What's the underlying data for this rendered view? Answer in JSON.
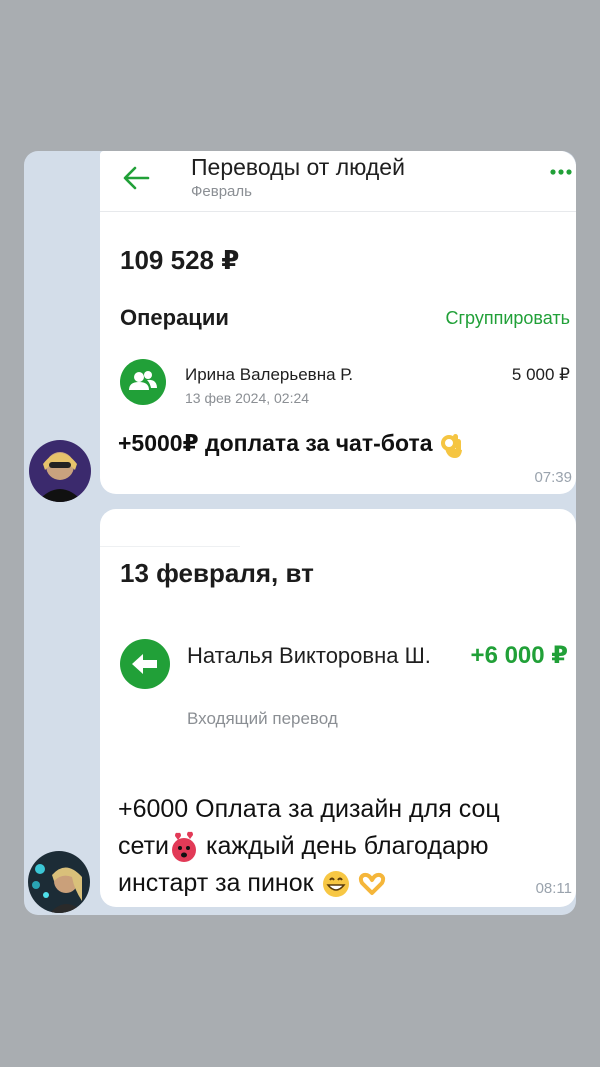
{
  "header": {
    "title": "Переводы от людей",
    "subtitle": "Февраль"
  },
  "summary": {
    "total": "109 528 ₽",
    "operations_label": "Операции",
    "group_button": "Сгруппировать"
  },
  "transaction1": {
    "name": "Ирина Валерьевна Р.",
    "date": "13 фев 2024, 02:24",
    "amount": "5 000 ₽"
  },
  "message1": {
    "text": "+5000₽ доплата за чат-бота",
    "emoji": "ok-hand-emoji",
    "time": "07:39"
  },
  "screenshot2": {
    "date_header": "13 февраля, вт",
    "name": "Наталья Викторовна Ш.",
    "amount": "+6 000 ₽",
    "type": "Входящий перевод"
  },
  "message2": {
    "line1": "+6000 Оплата за дизайн для соц",
    "line2_a": "сети",
    "line2_b": "каждый день благодарю",
    "line3": "инстарт за пинок",
    "emojis": [
      "face-with-hearts-emoji",
      "grinning-face-emoji",
      "heart-hands-emoji"
    ],
    "time": "08:11"
  },
  "colors": {
    "accent": "#21a038",
    "background": "#a9adb1",
    "chat_bg": "#d3dde9"
  }
}
